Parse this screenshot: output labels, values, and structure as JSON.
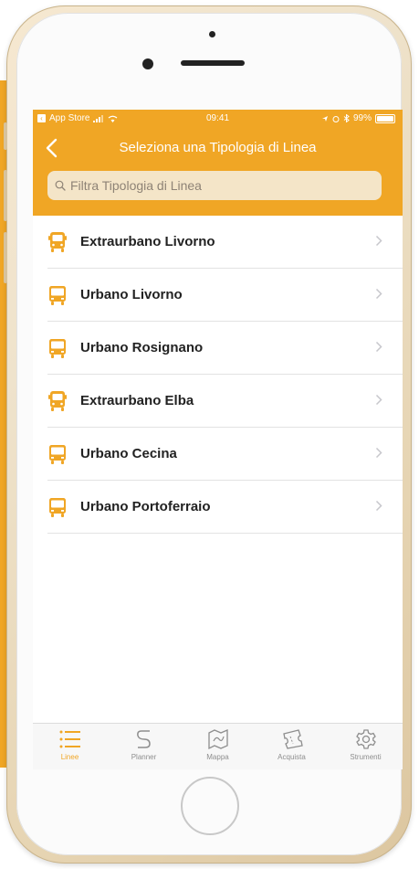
{
  "status_bar": {
    "carrier": "App Store",
    "time": "09:41",
    "battery": "99%",
    "battery_level": 0.99
  },
  "nav": {
    "title": "Seleziona una Tipologia di Linea",
    "back_icon": "chevron-left-icon"
  },
  "search": {
    "placeholder": "Filtra Tipologia di Linea"
  },
  "list": {
    "items": [
      {
        "label": "Extraurbano Livorno",
        "icon": "coach-bus-icon"
      },
      {
        "label": "Urbano Livorno",
        "icon": "city-bus-icon"
      },
      {
        "label": "Urbano Rosignano",
        "icon": "city-bus-icon"
      },
      {
        "label": "Extraurbano Elba",
        "icon": "coach-bus-icon"
      },
      {
        "label": "Urbano Cecina",
        "icon": "city-bus-icon"
      },
      {
        "label": "Urbano Portoferraio",
        "icon": "city-bus-icon"
      }
    ]
  },
  "tabs": [
    {
      "label": "Linee",
      "icon": "list-icon",
      "active": true
    },
    {
      "label": "Planner",
      "icon": "route-icon",
      "active": false
    },
    {
      "label": "Mappa",
      "icon": "map-icon",
      "active": false
    },
    {
      "label": "Acquista",
      "icon": "ticket-icon",
      "active": false
    },
    {
      "label": "Strumenti",
      "icon": "gear-icon",
      "active": false
    }
  ],
  "colors": {
    "accent": "#f0a625",
    "search_bg": "#f4e5c8",
    "tab_inactive": "#8e8e8e"
  }
}
